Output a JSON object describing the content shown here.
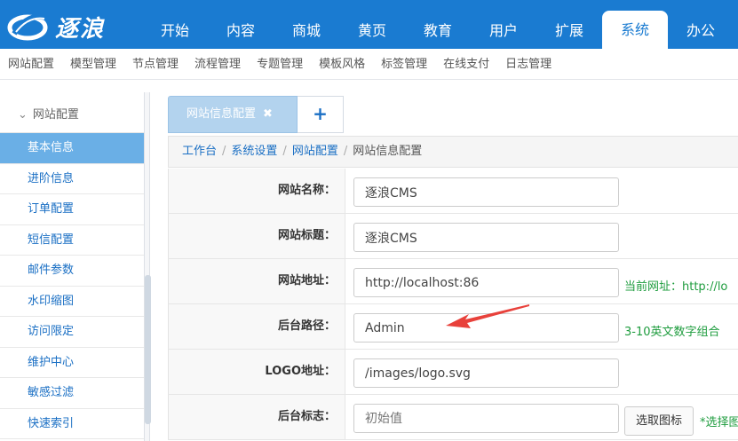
{
  "brand": {
    "logo_text": "逐浪"
  },
  "nav": {
    "items": [
      "开始",
      "内容",
      "商城",
      "黄页",
      "教育",
      "用户",
      "扩展",
      "系统",
      "办公"
    ],
    "active": "系统"
  },
  "subnav": {
    "items": [
      "网站配置",
      "模型管理",
      "节点管理",
      "流程管理",
      "专题管理",
      "模板风格",
      "标签管理",
      "在线支付",
      "日志管理"
    ]
  },
  "sidebar": {
    "section": "网站配置",
    "items": [
      "基本信息",
      "进阶信息",
      "订单配置",
      "短信配置",
      "邮件参数",
      "水印缩图",
      "访问限定",
      "维护中心",
      "敏感过滤",
      "快速索引"
    ],
    "active": "基本信息"
  },
  "tabs": {
    "items": [
      {
        "label": "网站信息配置",
        "close": "✖"
      }
    ],
    "add_label": "+"
  },
  "breadcrumb": {
    "items": [
      "工作台",
      "系统设置",
      "网站配置"
    ],
    "separator": "/",
    "current": "网站信息配置"
  },
  "form": {
    "rows": [
      {
        "label": "网站名称：",
        "value": "逐浪CMS"
      },
      {
        "label": "网站标题：",
        "value": "逐浪CMS"
      },
      {
        "label": "网站地址：",
        "value": "http://localhost:86",
        "hint": "当前网址：http://lo"
      },
      {
        "label": "后台路径：",
        "value": "Admin",
        "hint": "3-10英文数字组合"
      },
      {
        "label": "LOGO地址：",
        "value": "/images/logo.svg"
      },
      {
        "label": "后台标志：",
        "placeholder": "初始值",
        "button": "选取图标",
        "hint": "*选择图"
      }
    ]
  },
  "colors": {
    "primary": "#1a7bd1",
    "sidebar_active": "#6aafe6",
    "link": "#1a6fc4",
    "hint_green": "#1e9c3e",
    "annotation_arrow": "#e8413b"
  }
}
